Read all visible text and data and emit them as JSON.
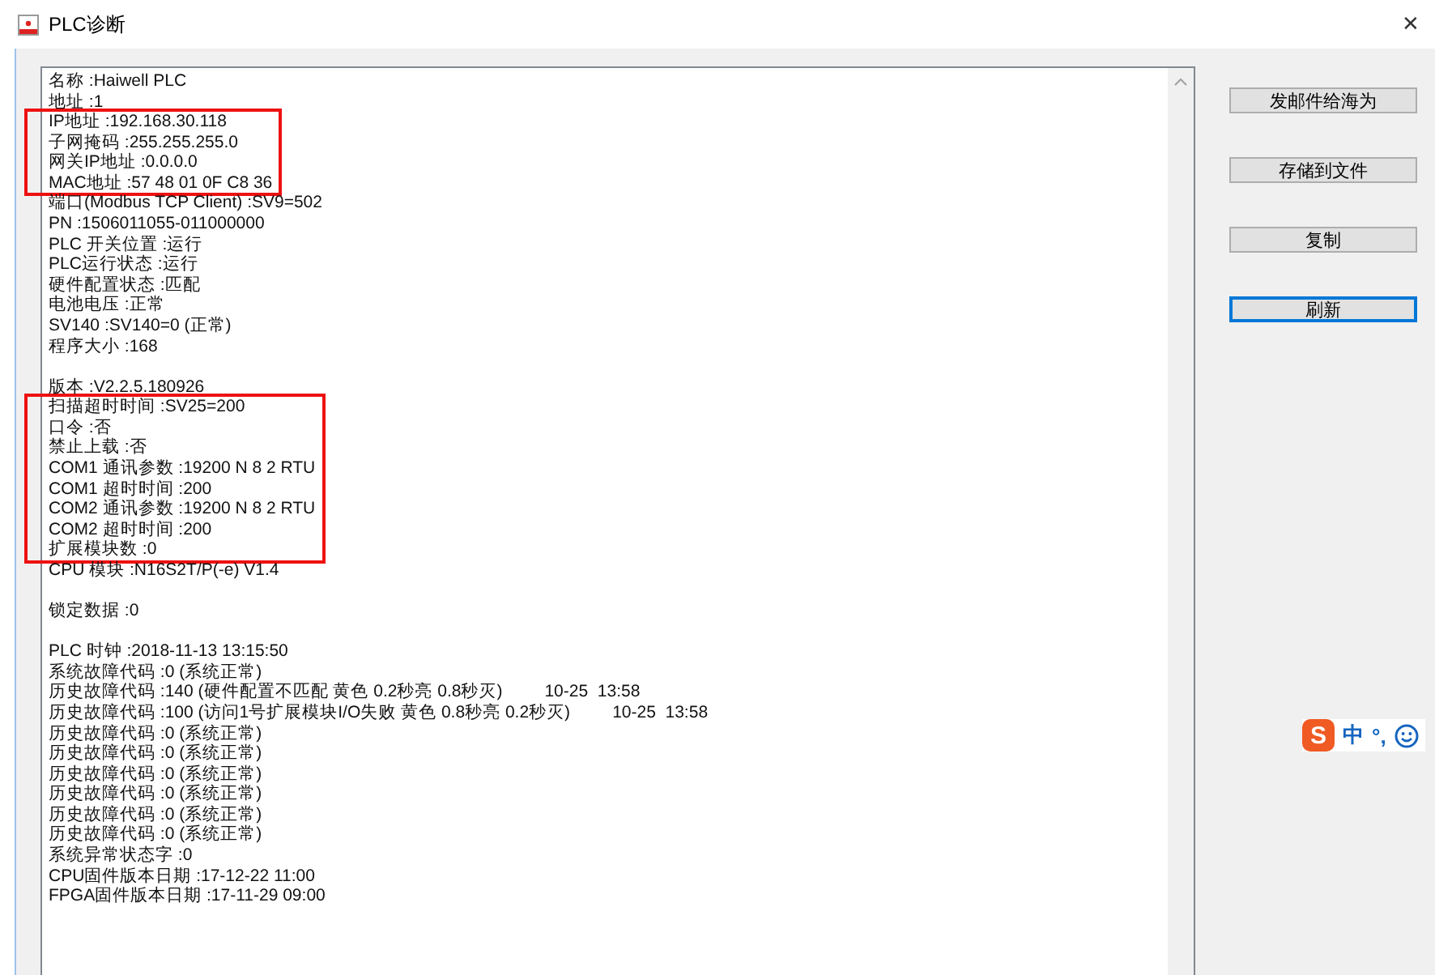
{
  "window": {
    "title": "PLC诊断",
    "close": "✕"
  },
  "report": {
    "blocks": [
      {
        "highlighted": false,
        "lines": [
          {
            "kind": "text",
            "text": "名称 :Haiwell PLC"
          },
          {
            "kind": "text",
            "text": "地址 :1"
          }
        ]
      },
      {
        "highlighted": true,
        "lines": [
          {
            "kind": "text",
            "text": "IP地址 :192.168.30.118"
          },
          {
            "kind": "text",
            "text": "子网掩码 :255.255.255.0"
          },
          {
            "kind": "text",
            "text": "网关IP地址 :0.0.0.0"
          },
          {
            "kind": "text",
            "text": "MAC地址 :57 48 01 0F C8 36"
          }
        ]
      },
      {
        "highlighted": false,
        "lines": [
          {
            "kind": "text",
            "text": "端口(Modbus TCP Client) :SV9=502"
          },
          {
            "kind": "text",
            "text": "PN :1506011055-011000000"
          },
          {
            "kind": "text",
            "text": "PLC 开关位置 :运行"
          },
          {
            "kind": "text",
            "text": "PLC运行状态 :运行"
          },
          {
            "kind": "text",
            "text": "硬件配置状态 :匹配"
          },
          {
            "kind": "text",
            "text": "电池电压 :正常"
          },
          {
            "kind": "text",
            "text": "SV140 :SV140=0 (正常)"
          },
          {
            "kind": "text",
            "text": "程序大小 :168"
          },
          {
            "kind": "blank"
          },
          {
            "kind": "text",
            "text": "版本 :V2.2.5.180926"
          }
        ]
      },
      {
        "highlighted": true,
        "lines": [
          {
            "kind": "text",
            "text": "扫描超时时间 :SV25=200"
          },
          {
            "kind": "text",
            "text": "口令 :否"
          },
          {
            "kind": "text",
            "text": "禁止上载 :否"
          },
          {
            "kind": "text",
            "text": "COM1 通讯参数 :19200 N 8 2 RTU"
          },
          {
            "kind": "text",
            "text": "COM1 超时时间 :200"
          },
          {
            "kind": "text",
            "text": "COM2 通讯参数 :19200 N 8 2 RTU"
          },
          {
            "kind": "text",
            "text": "COM2 超时时间 :200"
          },
          {
            "kind": "text",
            "text": "扩展模块数 :0"
          }
        ]
      },
      {
        "highlighted": false,
        "lines": [
          {
            "kind": "text",
            "text": "CPU 模块 :N16S2T/P(-e) V1.4"
          },
          {
            "kind": "blank"
          },
          {
            "kind": "text",
            "text": "锁定数据 :0"
          },
          {
            "kind": "blank"
          },
          {
            "kind": "text",
            "text": "PLC 时钟 :2018-11-13 13:15:50"
          },
          {
            "kind": "text",
            "text": "系统故障代码 :0 (系统正常)"
          },
          {
            "kind": "text",
            "text": "历史故障代码 :140 (硬件配置不匹配 黄色 0.2秒亮 0.8秒灭)",
            "time": "10-25  13:58"
          },
          {
            "kind": "text",
            "text": "历史故障代码 :100 (访问1号扩展模块I/O失败 黄色 0.8秒亮 0.2秒灭)",
            "time": "10-25  13:58"
          },
          {
            "kind": "text",
            "text": "历史故障代码 :0 (系统正常)"
          },
          {
            "kind": "text",
            "text": "历史故障代码 :0 (系统正常)"
          },
          {
            "kind": "text",
            "text": "历史故障代码 :0 (系统正常)"
          },
          {
            "kind": "text",
            "text": "历史故障代码 :0 (系统正常)"
          },
          {
            "kind": "text",
            "text": "历史故障代码 :0 (系统正常)"
          },
          {
            "kind": "text",
            "text": "历史故障代码 :0 (系统正常)"
          },
          {
            "kind": "text",
            "text": "系统异常状态字 :0"
          },
          {
            "kind": "text",
            "text": "CPU固件版本日期 :17-12-22 11:00"
          },
          {
            "kind": "text",
            "text": "FPGA固件版本日期 :17-11-29 09:00"
          }
        ]
      }
    ]
  },
  "buttons": [
    {
      "label": "发邮件给海为",
      "focused": false
    },
    {
      "label": "存储到文件",
      "focused": false
    },
    {
      "label": "复制",
      "focused": false
    },
    {
      "label": "刷新",
      "focused": true
    }
  ],
  "ime_bar": {
    "logo": "S",
    "mode": "中",
    "punct": "°,"
  }
}
